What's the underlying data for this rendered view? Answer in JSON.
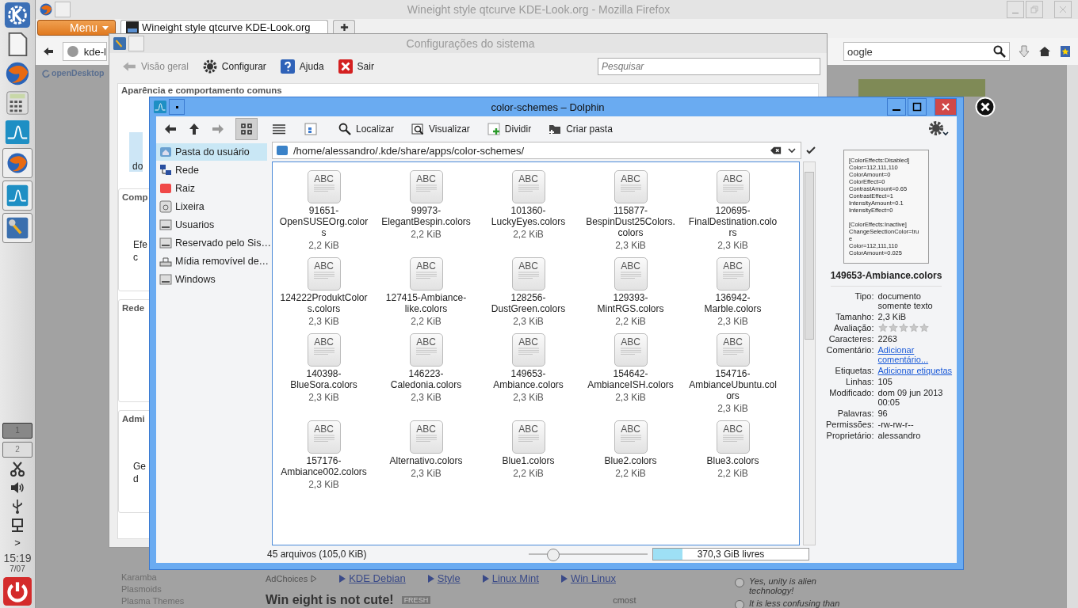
{
  "panel": {
    "pager": [
      {
        "label": "1",
        "selected": true
      },
      {
        "label": "2",
        "selected": false
      }
    ],
    "tray_expander": ">",
    "clock": {
      "time": "15:19",
      "date": "7/07"
    }
  },
  "firefox": {
    "title": "Wineight style qtcurve KDE-Look.org - Mozilla Firefox",
    "menu_button": "Menu",
    "tabs": [
      {
        "label": "Wineight style qtcurve KDE-Look.org",
        "selected": true
      }
    ],
    "url": "kde-l",
    "search": "oogle",
    "site_logo": "openDesktop",
    "sidebar_links": [
      "Karamba",
      "Plasmoids",
      "Plasma Themes"
    ],
    "adchoices": "AdChoices",
    "ad_links": [
      "KDE Debian",
      "Style",
      "Linux Mint",
      "Win Linux"
    ],
    "poll_options": [
      {
        "label": "Yes, unity is alien technology!",
        "selected": false
      },
      {
        "label": "It is less confusing than",
        "selected": false
      }
    ],
    "article_title": "Win eight is not cute!",
    "badge": "FRESH",
    "author": "cmost"
  },
  "settings": {
    "title": "Configurações do sistema",
    "toolbar": [
      {
        "kind": "back",
        "label": "Visão geral",
        "disabled": true
      },
      {
        "kind": "configure",
        "label": "Configurar",
        "disabled": false
      },
      {
        "kind": "help",
        "label": "Ajuda",
        "disabled": false
      },
      {
        "kind": "quit",
        "label": "Sair",
        "disabled": false
      }
    ],
    "search_placeholder": "Pesquisar",
    "sections": [
      {
        "title": "Aparência e comportamento comuns",
        "items": [
          "do"
        ]
      },
      {
        "title": "Comp",
        "items": [
          "Efe",
          "c"
        ]
      },
      {
        "title": "Rede"
      },
      {
        "title": "Admi",
        "items": [
          "Ge",
          "d"
        ]
      }
    ]
  },
  "dolphin": {
    "title": "color-schemes – Dolphin",
    "view_modes": [
      {
        "kind": "icons",
        "selected": true
      },
      {
        "kind": "details",
        "selected": false
      },
      {
        "kind": "columns",
        "selected": false
      }
    ],
    "actions": [
      {
        "kind": "find",
        "label": "Localizar"
      },
      {
        "kind": "preview",
        "label": "Visualizar"
      },
      {
        "kind": "split",
        "label": "Dividir"
      },
      {
        "kind": "newfolder",
        "label": "Criar pasta"
      }
    ],
    "places": [
      {
        "kind": "home",
        "label": "Pasta do usuário",
        "selected": true
      },
      {
        "kind": "network",
        "label": "Rede",
        "selected": false
      },
      {
        "kind": "root",
        "label": "Raiz",
        "selected": false
      },
      {
        "kind": "trash",
        "label": "Lixeira",
        "selected": false
      },
      {
        "kind": "drive",
        "label": "Usuarios",
        "selected": false
      },
      {
        "kind": "drive",
        "label": "Reservado pelo Sis…",
        "selected": false
      },
      {
        "kind": "removable",
        "label": "Mídia removível de…",
        "selected": false
      },
      {
        "kind": "drive",
        "label": "Windows",
        "selected": false
      }
    ],
    "path": "/home/alessandro/.kde/share/apps/color-schemes/",
    "files": [
      {
        "icon_label": "ABC",
        "name": "91651-OpenSUSEOrg.colors",
        "size": "2,2 KiB"
      },
      {
        "icon_label": "ABC",
        "name": "99973-ElegantBespin.colors",
        "size": "2,2 KiB"
      },
      {
        "icon_label": "ABC",
        "name": "101360-LuckyEyes.colors",
        "size": "2,2 KiB"
      },
      {
        "icon_label": "ABC",
        "name": "115877-BespinDust25Colors.colors",
        "size": "2,3 KiB"
      },
      {
        "icon_label": "ABC",
        "name": "120695-FinalDestination.colors",
        "size": "2,3 KiB"
      },
      {
        "icon_label": "ABC",
        "name": "124222ProduktColors.colors",
        "size": "2,3 KiB"
      },
      {
        "icon_label": "ABC",
        "name": "127415-Ambiance-like.colors",
        "size": "2,2 KiB"
      },
      {
        "icon_label": "ABC",
        "name": "128256-DustGreen.colors",
        "size": "2,3 KiB"
      },
      {
        "icon_label": "ABC",
        "name": "129393-MintRGS.colors",
        "size": "2,2 KiB"
      },
      {
        "icon_label": "ABC",
        "name": "136942-Marble.colors",
        "size": "2,3 KiB"
      },
      {
        "icon_label": "ABC",
        "name": "140398-BlueSora.colors",
        "size": "2,3 KiB"
      },
      {
        "icon_label": "ABC",
        "name": "146223-Caledonia.colors",
        "size": "2,3 KiB"
      },
      {
        "icon_label": "ABC",
        "name": "149653-Ambiance.colors",
        "size": "2,3 KiB"
      },
      {
        "icon_label": "ABC",
        "name": "154642-AmbianceISH.colors",
        "size": "2,3 KiB"
      },
      {
        "icon_label": "ABC",
        "name": "154716-AmbianceUbuntu.colors",
        "size": "2,3 KiB"
      },
      {
        "icon_label": "ABC",
        "name": "157176-Ambiance002.colors",
        "size": "2,3 KiB"
      },
      {
        "icon_label": "ABC",
        "name": "Alternativo.colors",
        "size": "2,3 KiB"
      },
      {
        "icon_label": "ABC",
        "name": "Blue1.colors",
        "size": "2,2 KiB"
      },
      {
        "icon_label": "ABC",
        "name": "Blue2.colors",
        "size": "2,2 KiB"
      },
      {
        "icon_label": "ABC",
        "name": "Blue3.colors",
        "size": "2,2 KiB"
      }
    ],
    "info": {
      "preview_blocks": [
        [
          "[ColorEffects:Disabled]",
          "Color=112,111,110",
          "ColorAmount=0",
          "ColorEffect=0",
          "ContrastAmount=0.65",
          "ContrastEffect=1",
          "IntensityAmount=0.1",
          "IntensityEffect=0"
        ],
        [
          "[ColorEffects:Inactive]",
          "ChangeSelectionColor=tru",
          "e",
          "Color=112,111,110",
          "ColorAmount=0.025"
        ]
      ],
      "name": "149653-Ambiance.colors",
      "properties": [
        {
          "kind": "text",
          "label": "Tipo:",
          "value": "documento somente texto"
        },
        {
          "kind": "text",
          "label": "Tamanho:",
          "value": "2,3 KiB"
        },
        {
          "kind": "rating",
          "label": "Avaliação:",
          "stars": 0
        },
        {
          "kind": "text",
          "label": "Caracteres:",
          "value": "2263"
        },
        {
          "kind": "link",
          "label": "Comentário:",
          "value": "Adicionar comentário..."
        },
        {
          "kind": "link",
          "label": "Etiquetas:",
          "value": "Adicionar etiquetas"
        },
        {
          "kind": "text",
          "label": "Linhas:",
          "value": "105"
        },
        {
          "kind": "text",
          "label": "Modificado:",
          "value": "dom 09 jun 2013 00:05"
        },
        {
          "kind": "text",
          "label": "Palavras:",
          "value": "96"
        },
        {
          "kind": "text",
          "label": "Permissões:",
          "value": "-rw-rw-r--"
        },
        {
          "kind": "text",
          "label": "Proprietário:",
          "value": "alessandro"
        }
      ]
    },
    "status": "45 arquivos (105,0 KiB)",
    "zoom": {
      "level": 0.2
    },
    "free_space": {
      "label": "370,3 GiB livres",
      "level": 0.19
    }
  }
}
